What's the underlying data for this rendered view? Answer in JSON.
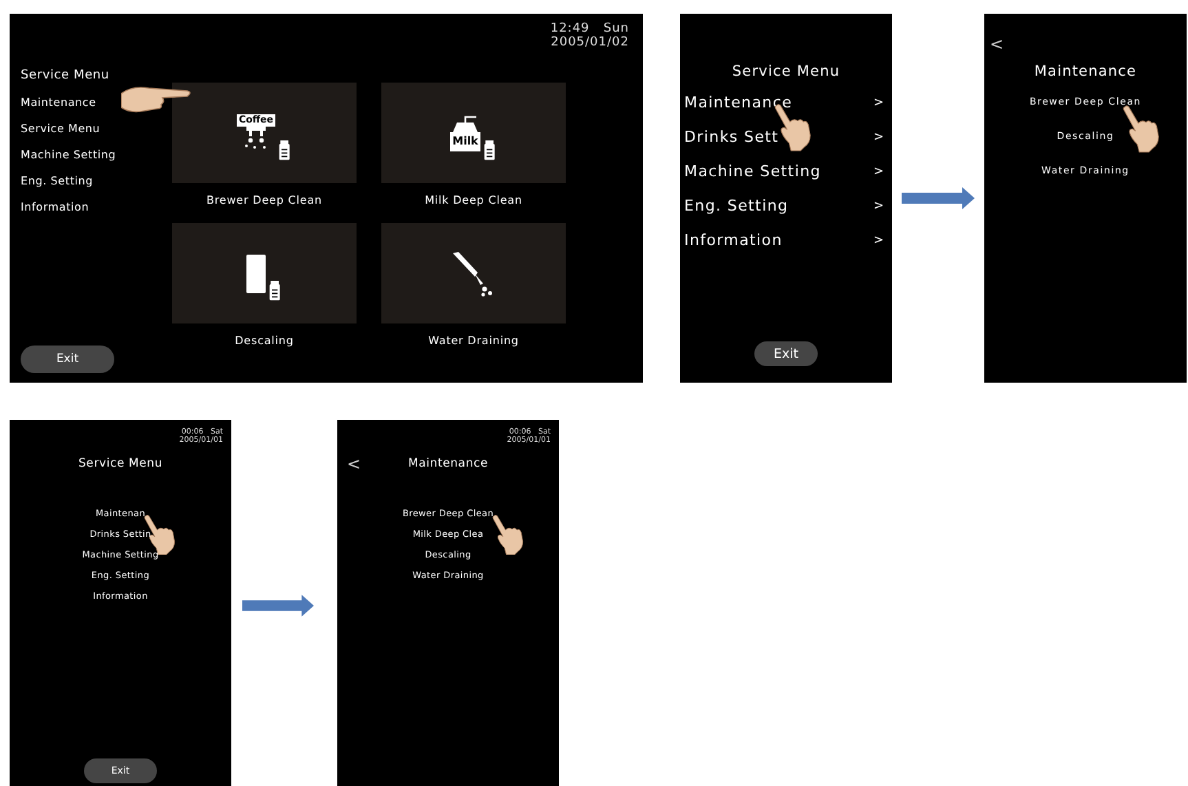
{
  "screens": [
    {
      "kind": "grid",
      "clock": {
        "time": "12:49",
        "day": "Sun",
        "date": "2005/01/02"
      },
      "title": "Service Menu",
      "items": [
        {
          "label": "Maintenance",
          "pointed": true
        },
        {
          "label": "Service Menu",
          "pointed": false
        },
        {
          "label": "Machine Setting",
          "pointed": false
        },
        {
          "label": "Eng. Setting",
          "pointed": false
        },
        {
          "label": "Information",
          "pointed": false
        }
      ],
      "tiles": [
        {
          "kind": "brewer",
          "badge": "Coffee",
          "label": "Brewer Deep Clean"
        },
        {
          "kind": "milk",
          "badge": "Milk",
          "label": "Milk Deep Clean"
        },
        {
          "kind": "descaling",
          "label": "Descaling"
        },
        {
          "kind": "draining",
          "label": "Water Draining"
        }
      ],
      "exit": "Exit"
    },
    {
      "kind": "list",
      "title": "Service Menu",
      "items": [
        {
          "label": "Maintenance",
          "arrow": ">",
          "pointed": true
        },
        {
          "label": "Drinks Sett",
          "arrow": ">",
          "pointed": false
        },
        {
          "label": "Machine Setting",
          "arrow": ">",
          "pointed": false
        },
        {
          "label": "Eng. Setting",
          "arrow": ">",
          "pointed": false
        },
        {
          "label": "Information",
          "arrow": ">",
          "pointed": false
        }
      ],
      "exit": "Exit"
    },
    {
      "kind": "submenu",
      "back": "<",
      "title": "Maintenance",
      "items": [
        {
          "label": "Brewer Deep Clean",
          "pointed": true
        },
        {
          "label": "Descaling",
          "pointed": false
        },
        {
          "label": "Water Draining",
          "pointed": false
        }
      ]
    },
    {
      "kind": "compact_list",
      "clock": {
        "time": "00:06",
        "day": "Sat",
        "date": "2005/01/01"
      },
      "title": "Service Menu",
      "items": [
        {
          "label": "Maintenan",
          "pointed": true
        },
        {
          "label": "Drinks Settin",
          "pointed": false
        },
        {
          "label": "Machine Setting",
          "pointed": false
        },
        {
          "label": "Eng. Setting",
          "pointed": false
        },
        {
          "label": "Information",
          "pointed": false
        }
      ],
      "exit": "Exit"
    },
    {
      "kind": "compact_submenu",
      "back": "<",
      "clock": {
        "time": "00:06",
        "day": "Sat",
        "date": "2005/01/01"
      },
      "title": "Maintenance",
      "items": [
        {
          "label": "Brewer Deep Clean",
          "pointed": true
        },
        {
          "label": "Milk Deep Clea",
          "pointed": false
        },
        {
          "label": "Descaling",
          "pointed": false
        },
        {
          "label": "Water Draining",
          "pointed": false
        }
      ]
    }
  ]
}
